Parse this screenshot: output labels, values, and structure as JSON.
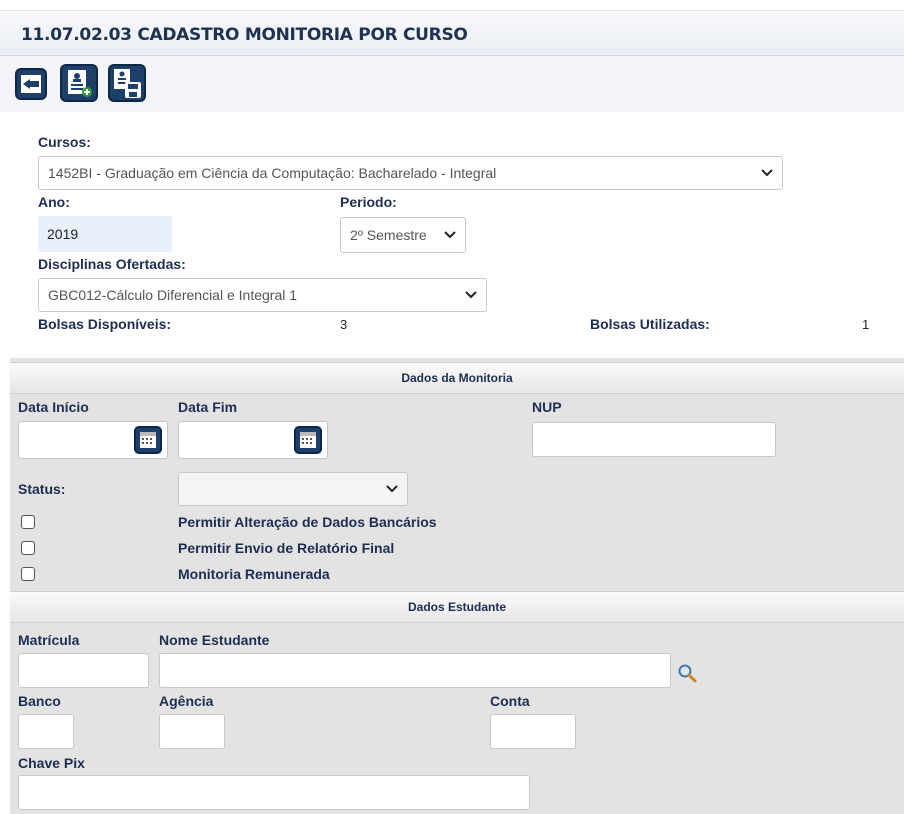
{
  "header": {
    "title": "11.07.02.03 CADASTRO MONITORIA POR CURSO"
  },
  "toolbar": {
    "icons": [
      "back-icon",
      "new-document-icon",
      "save-icon"
    ]
  },
  "form": {
    "cursos_label": "Cursos:",
    "cursos_value": "1452BI - Graduação em Ciência da Computação: Bacharelado - Integral",
    "ano_label": "Ano:",
    "ano_value": "2019",
    "periodo_label": "Periodo:",
    "periodo_value": "2º Semestre",
    "disciplinas_label": "Disciplinas Ofertadas:",
    "disciplinas_value": "GBC012-Cálculo Diferencial e Integral 1",
    "bolsas_disp_label": "Bolsas Disponíveis:",
    "bolsas_disp_value": "3",
    "bolsas_util_label": "Bolsas Utilizadas:",
    "bolsas_util_value": "1"
  },
  "monitoria": {
    "section_title": "Dados da Monitoria",
    "data_inicio_label": "Data Início",
    "data_fim_label": "Data Fim",
    "nup_label": "NUP",
    "status_label": "Status:",
    "status_value": "",
    "checkboxes": [
      {
        "label": "Permitir Alteração de Dados Bancários",
        "checked": false
      },
      {
        "label": "Permitir Envio de Relatório Final",
        "checked": false
      },
      {
        "label": "Monitoria Remunerada",
        "checked": false
      }
    ]
  },
  "estudante": {
    "section_title": "Dados Estudante",
    "matricula_label": "Matrícula",
    "nome_label": "Nome Estudante",
    "banco_label": "Banco",
    "agencia_label": "Agência",
    "conta_label": "Conta",
    "chave_pix_label": "Chave Pix"
  },
  "colors": {
    "accent": "#1d3f69",
    "label": "#1d2e52",
    "section_bg": "#e3e3e3"
  }
}
